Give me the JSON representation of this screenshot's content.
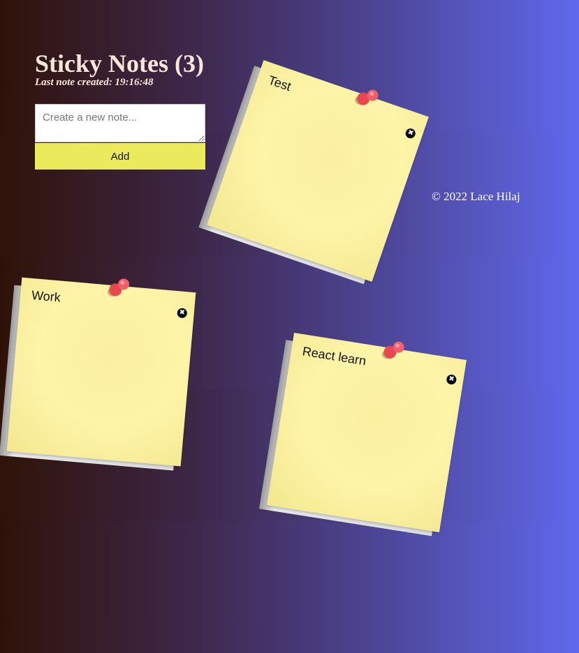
{
  "header": {
    "title": "Sticky Notes (3)",
    "last_created": "Last note created: 19:16:48"
  },
  "form": {
    "placeholder": "Create a new note...",
    "value": "",
    "add_label": "Add"
  },
  "notes": [
    {
      "title": "Test"
    },
    {
      "title": "Work"
    },
    {
      "title": "React learn"
    }
  ],
  "close_glyph": "✖",
  "footer": {
    "copyright": "©  2022 Lace Hilaj"
  }
}
